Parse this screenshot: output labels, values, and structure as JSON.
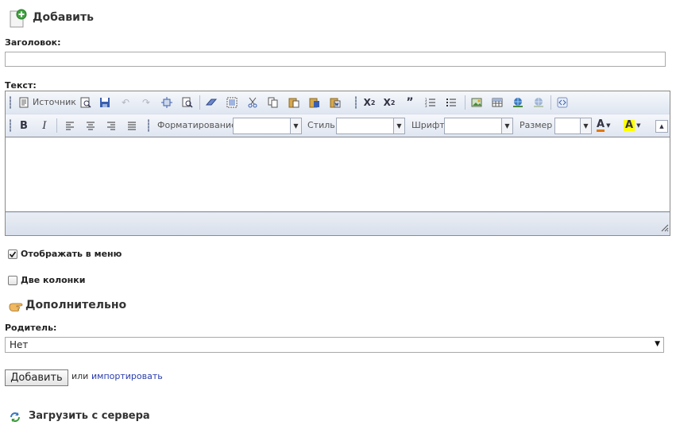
{
  "header": {
    "title": "Добавить",
    "icon": "add-document-icon"
  },
  "form": {
    "title_label": "Заголовок:",
    "title_value": "",
    "text_label": "Текст:",
    "show_in_menu_label": "Отображать в меню",
    "show_in_menu_checked": true,
    "two_columns_label": "Две колонки",
    "two_columns_checked": false
  },
  "editor": {
    "source_label": "Источник",
    "format_label": "Форматирование",
    "style_label": "Стиль",
    "font_label": "Шрифт",
    "size_label": "Размер",
    "format_value": "",
    "style_value": "",
    "font_value": "",
    "size_value": "",
    "text_color_letter": "A",
    "bg_color_letter": "A",
    "highlight_color": "#ffff00",
    "text_color": "#e07800"
  },
  "additional": {
    "title": "Дополнительно",
    "icon": "pointing-hand-icon",
    "parent_label": "Родитель:",
    "parent_value": "Нет"
  },
  "actions": {
    "submit_label": "Добавить",
    "or_text": "или",
    "import_link": "импортировать"
  },
  "footer": {
    "load_title": "Загрузить с сервера",
    "icon": "refresh-icon"
  }
}
